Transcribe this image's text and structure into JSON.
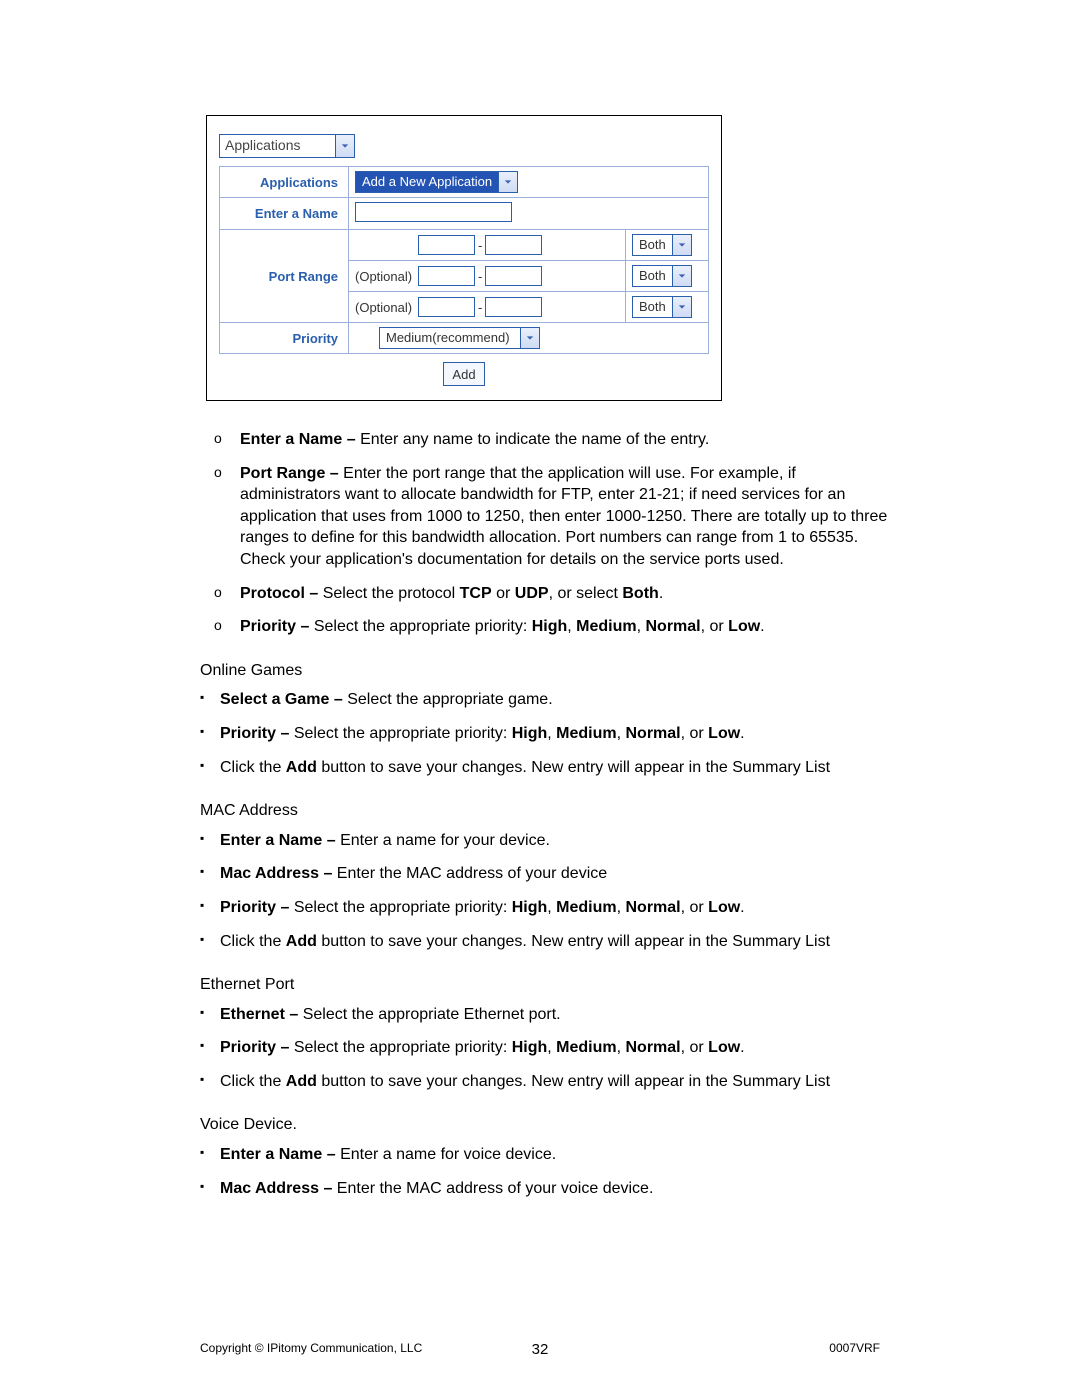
{
  "panel": {
    "category_dropdown": "Applications",
    "rows": {
      "applications": {
        "label": "Applications",
        "value": "Add a New Application"
      },
      "enter_name": {
        "label": "Enter a Name"
      },
      "port_range": {
        "label": "Port Range",
        "optional": "(Optional)",
        "protocol": "Both"
      },
      "priority": {
        "label": "Priority",
        "value": "Medium(recommend)"
      }
    },
    "add_button": "Add"
  },
  "desc": {
    "enter_name": {
      "b": "Enter a Name – ",
      "t": "Enter any name to indicate the name of the entry."
    },
    "port_range": {
      "b": "Port Range – ",
      "t": "Enter the port range that the application will use. For example, if administrators want to allocate bandwidth for FTP, enter 21-21; if need services for an application that uses from 1000 to 1250, then enter 1000-1250. There are totally up to three ranges to define for this bandwidth allocation. Port numbers can range from 1 to 65535. Check your application's documentation for details on the service ports used."
    },
    "protocol": {
      "pre": "Protocol – ",
      "mid1": "Select the protocol ",
      "b1": "TCP",
      "mid2": " or ",
      "b2": "UDP",
      "mid3": ", or select ",
      "b3": "Both",
      "end": "."
    },
    "priority": {
      "pre": "Priority – ",
      "mid": "Select the appropriate priority: ",
      "b1": "High",
      "b2": "Medium",
      "b3": "Normal",
      "b4": "Low",
      "end": "."
    }
  },
  "sections": {
    "online_games": {
      "title": "Online Games",
      "select_game": {
        "b": "Select a Game – ",
        "t": "Select the appropriate game."
      },
      "add": {
        "pre": "Click the ",
        "b": "Add",
        "post": " button to save your changes. New entry will appear in the Summary List"
      }
    },
    "mac": {
      "title": "MAC Address",
      "name": {
        "b": "Enter a Name – ",
        "t": "Enter a name for your device."
      },
      "mac": {
        "b": "Mac Address – ",
        "t": "Enter the MAC address of your device"
      }
    },
    "eth": {
      "title": "Ethernet Port",
      "eth": {
        "b": "Ethernet – ",
        "t": "Select the appropriate Ethernet port."
      }
    },
    "voice": {
      "title": "Voice Device.",
      "name": {
        "b": "Enter a Name – ",
        "t": "Enter a name for voice device."
      },
      "mac": {
        "b": "Mac Address – ",
        "t": "Enter the MAC address of your voice device."
      }
    }
  },
  "footer": {
    "left": "Copyright © IPitomy Communication, LLC",
    "center": "32",
    "right": "0007VRF"
  }
}
